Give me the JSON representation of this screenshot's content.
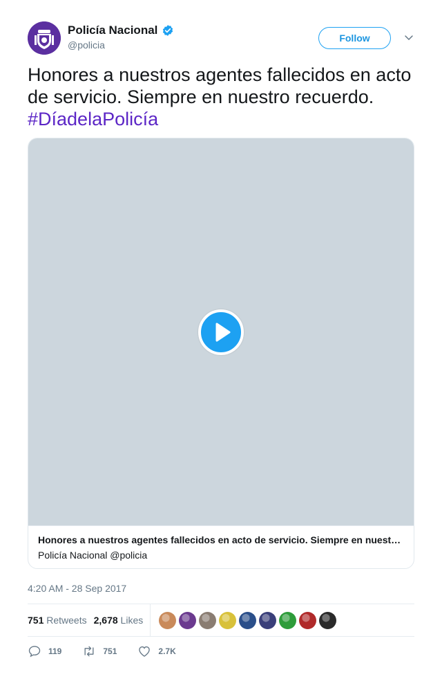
{
  "author": {
    "display_name": "Policía Nacional",
    "handle": "@policia",
    "verified": true,
    "avatar_icon": "police-badge-icon",
    "avatar_color": "#5b2fa0"
  },
  "follow_label": "Follow",
  "tweet": {
    "text": "Honores a nuestros agentes fallecidos en acto de servicio. Siempre en nuestro recuerdo. ",
    "hashtag": "#DíadelaPolicía"
  },
  "media": {
    "type": "video",
    "play_icon": "play-icon",
    "card_title": "Honores a nuestros agentes fallecidos en acto de servicio. Siempre en nuestro recuerdo. #DíadelaPolicía",
    "card_subtitle": "Policía Nacional @policia"
  },
  "timestamp": "4:20 AM - 28 Sep 2017",
  "stats": {
    "retweets_count": "751",
    "retweets_label": "Retweets",
    "likes_count": "2,678",
    "likes_label": "Likes",
    "likers": [
      "#c98a5a",
      "#6b3a8f",
      "#8a7d72",
      "#d8c13a",
      "#2b4f8a",
      "#3a3f7a",
      "#2e9c3a",
      "#b02a2a",
      "#2a2a2a"
    ]
  },
  "actions": {
    "replies": "119",
    "retweets": "751",
    "likes": "2.7K"
  },
  "colors": {
    "accent": "#1da1f2",
    "hashtag": "#5c26c6",
    "muted": "#657786"
  }
}
